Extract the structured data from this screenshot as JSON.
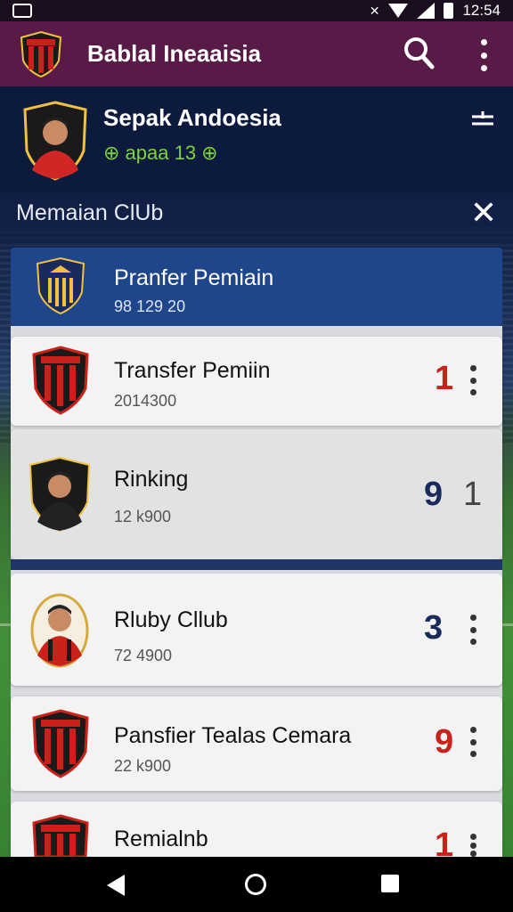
{
  "status_bar": {
    "time": "12:54"
  },
  "app_bar": {
    "title": "Bablal Ineaaisia"
  },
  "profile": {
    "name": "Sepak Andoesia",
    "subtitle": "⊕ apaa 13 ⊕"
  },
  "section": {
    "title": "Memaian ClUb"
  },
  "active_item": {
    "title": "Pranfer Pemiain",
    "subtitle": "98 129 20"
  },
  "items": [
    {
      "title": "Transfer Pemiin",
      "subtitle": "2014300",
      "number": "1",
      "number_color": "#c8221a"
    },
    {
      "title": "Rinking",
      "subtitle": "12 k900",
      "number": "9",
      "number2": "1",
      "number_color": "#1a2a5c"
    },
    {
      "title": "Rluby Cllub",
      "subtitle": "72 4900",
      "number": "3",
      "number_color": "#1a2a5c"
    },
    {
      "title": "Pansfier Tealas Cemara",
      "subtitle": "22 k900",
      "number": "9",
      "number_color": "#c8221a"
    },
    {
      "title": "Remialnb",
      "subtitle": "",
      "number": "1",
      "number_color": "#c8221a"
    }
  ],
  "colors": {
    "app_bar": "#581b47",
    "active": "#1f468a",
    "accent_green": "#7cd33a"
  }
}
